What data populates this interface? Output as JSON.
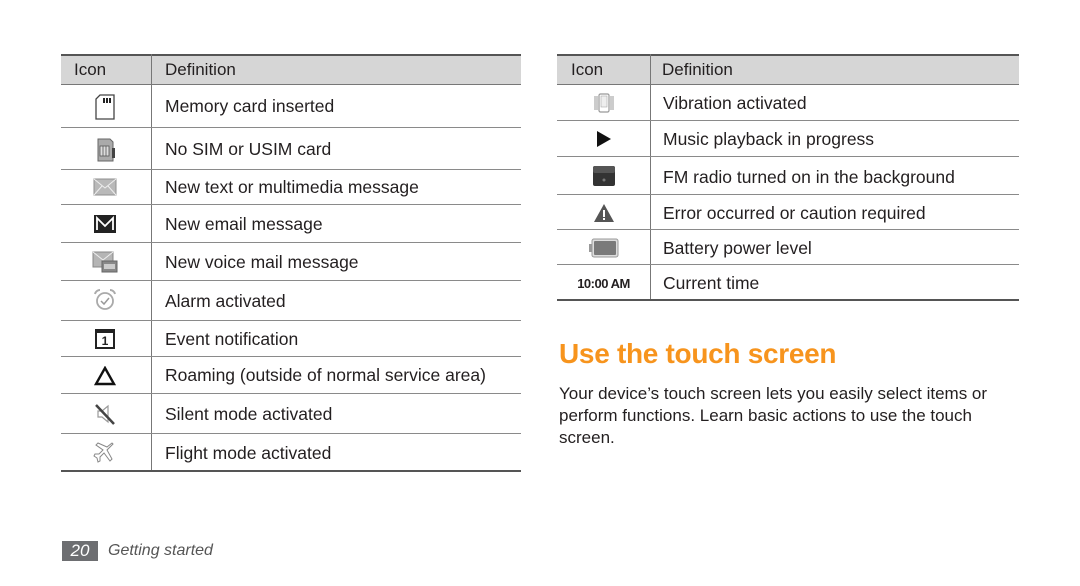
{
  "left_table": {
    "headers": {
      "icon": "Icon",
      "definition": "Definition"
    },
    "rows": [
      {
        "icon": "memory-card-icon",
        "definition": "Memory card inserted"
      },
      {
        "icon": "no-sim-icon",
        "definition": "No SIM or USIM card"
      },
      {
        "icon": "message-envelope-icon",
        "definition": "New text or multimedia message"
      },
      {
        "icon": "email-icon",
        "definition": "New email message"
      },
      {
        "icon": "voicemail-icon",
        "definition": "New voice mail message"
      },
      {
        "icon": "alarm-icon",
        "definition": "Alarm activated"
      },
      {
        "icon": "calendar-event-icon",
        "definition": "Event notification"
      },
      {
        "icon": "roaming-icon",
        "definition": "Roaming (outside of normal service area)"
      },
      {
        "icon": "silent-mode-icon",
        "definition": "Silent mode activated"
      },
      {
        "icon": "flight-mode-icon",
        "definition": "Flight mode activated"
      }
    ]
  },
  "right_table": {
    "headers": {
      "icon": "Icon",
      "definition": "Definition"
    },
    "rows": [
      {
        "icon": "vibration-icon",
        "definition": "Vibration activated"
      },
      {
        "icon": "play-icon",
        "definition": "Music playback in progress"
      },
      {
        "icon": "fm-radio-icon",
        "definition": "FM radio turned on in the background"
      },
      {
        "icon": "warning-icon",
        "definition": "Error occurred or caution required"
      },
      {
        "icon": "battery-icon",
        "definition": "Battery power level"
      },
      {
        "icon": "time-text",
        "icon_text": "10:00 AM",
        "definition": "Current time"
      }
    ]
  },
  "section": {
    "title": "Use the touch screen",
    "body": "Your device’s touch screen lets you easily select items or perform functions. Learn basic actions to use the touch screen."
  },
  "footer": {
    "page_number": "20",
    "chapter": "Getting started"
  },
  "colors": {
    "accent": "#f7941d",
    "header_bg": "#d6d6d6",
    "footer_badge": "#6d6e71"
  }
}
